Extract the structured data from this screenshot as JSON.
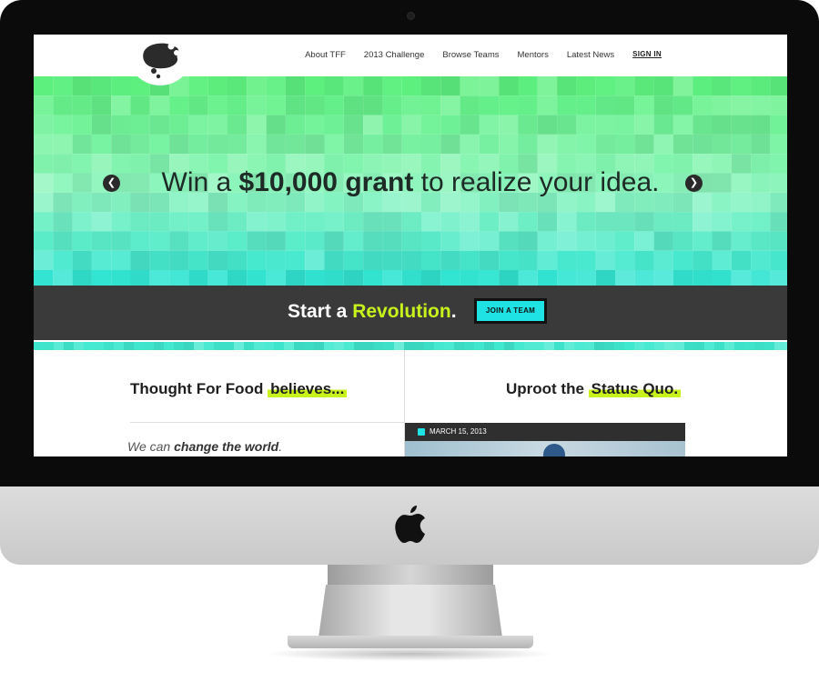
{
  "header": {
    "logo": "tff-logo",
    "nav": [
      {
        "label": "About TFF"
      },
      {
        "label": "2013 Challenge"
      },
      {
        "label": "Browse Teams"
      },
      {
        "label": "Mentors"
      },
      {
        "label": "Latest News"
      }
    ],
    "signin_label": "SIGN IN"
  },
  "hero": {
    "prefix": "Win a ",
    "amount": "$10,000 grant",
    "suffix": " to realize your idea.",
    "prev_icon": "chevron-left-icon",
    "next_icon": "chevron-right-icon",
    "colors": {
      "green": "#5df07f",
      "mint": "#8ef5c0",
      "teal": "#1ee2d6"
    }
  },
  "banner": {
    "prefix": "Start a ",
    "highlight": "Revolution",
    "suffix": ".",
    "button_label": "JOIN A TEAM",
    "button_color": "#1ee2e4",
    "highlight_color": "#c8f21b"
  },
  "left_column": {
    "title_prefix": "Thought For Food ",
    "title_highlight": "believes...",
    "text_prefix": "We can ",
    "text_bold": "change the world",
    "text_suffix": "."
  },
  "right_column": {
    "title_prefix": "Uproot the ",
    "title_highlight": "Status Quo.",
    "post_date": "MARCH 15, 2013",
    "date_icon": "calendar-icon"
  },
  "device": {
    "brand_icon": "apple-logo-icon"
  }
}
